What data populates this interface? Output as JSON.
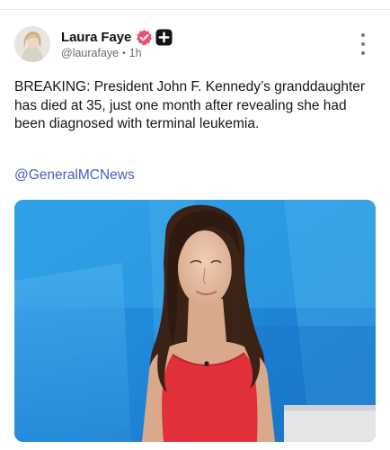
{
  "post": {
    "author": {
      "display_name": "Laura Faye",
      "handle": "@laurafaye",
      "separator": "•",
      "time": "1h",
      "badges": [
        "verified-icon",
        "plus-icon"
      ]
    },
    "body": "BREAKING: President John F. Kennedy’s granddaughter has died at 35, just one month after revealing she had been diagnosed with terminal leukemia.",
    "mention": "@GeneralMCNews",
    "menu_icon": "more-vertical-icon",
    "media": {
      "type": "photo"
    }
  },
  "colors": {
    "verified_badge": "#e8506f",
    "link": "#4660c4",
    "handle_text": "#6b6b73"
  }
}
